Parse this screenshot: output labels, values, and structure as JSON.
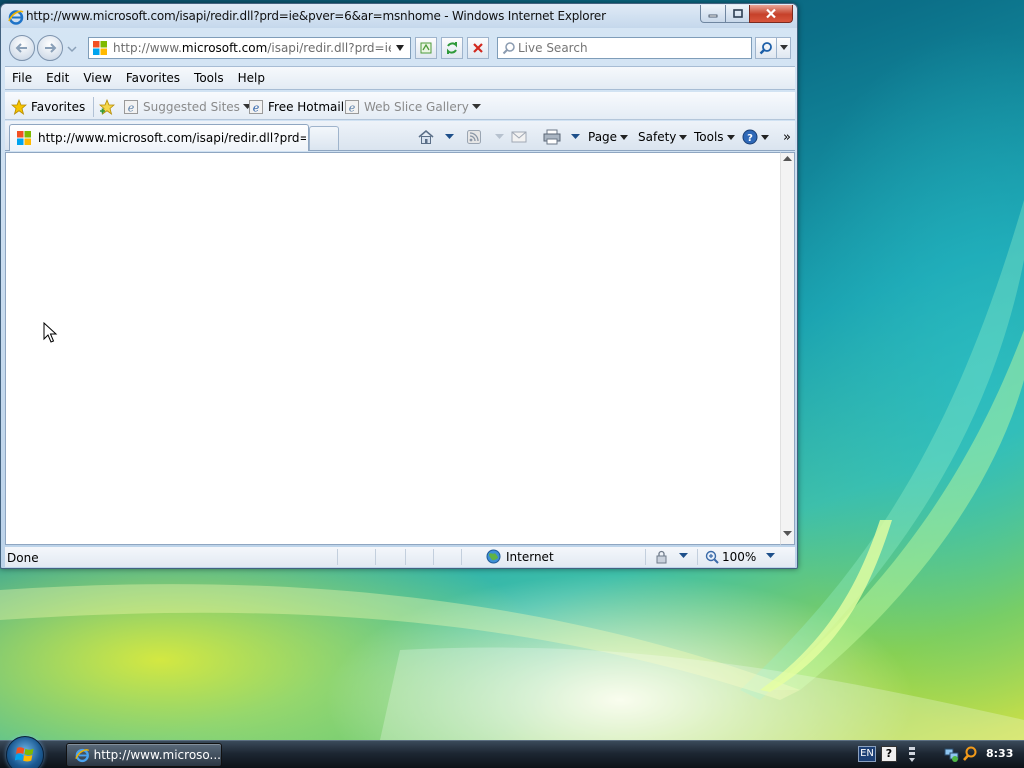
{
  "window": {
    "title": "http://www.microsoft.com/isapi/redir.dll?prd=ie&pver=6&ar=msnhome - Windows Internet Explorer"
  },
  "navbar": {
    "address_prefix": "http://www.",
    "address_domain": "microsoft.com",
    "address_suffix": "/isapi/redir.dll?prd=ie&pv",
    "search_placeholder": "Live Search"
  },
  "menu": {
    "items": [
      "File",
      "Edit",
      "View",
      "Favorites",
      "Tools",
      "Help"
    ]
  },
  "favorites_bar": {
    "favorites_label": "Favorites",
    "suggested_sites": "Suggested Sites",
    "free_hotmail": "Free Hotmail",
    "web_slice_gallery": "Web Slice Gallery"
  },
  "tabs": {
    "active_title": "http://www.microsoft.com/isapi/redir.dll?prd=ie..."
  },
  "command_bar": {
    "page": "Page",
    "safety": "Safety",
    "tools": "Tools",
    "more": "»"
  },
  "status_bar": {
    "status": "Done",
    "zone": "Internet",
    "zoom": "100%"
  },
  "taskbar": {
    "ie_button_label": "http://www.microso...",
    "language": "EN",
    "help": "?",
    "clock": "8:33"
  },
  "colors": {
    "window_frame": "#c5d8ec",
    "close_button": "#c6412a",
    "taskbar": "#1d2733",
    "link_gray": "#8a8a8a"
  },
  "icons": {
    "title": "ie-icon",
    "back": "back-arrow-icon",
    "forward": "forward-arrow-icon",
    "site": "windows-logo-icon",
    "compat": "compatibility-view-icon",
    "refresh": "refresh-icon",
    "stop": "stop-icon",
    "search": "magnifier-icon",
    "home": "home-icon",
    "feeds": "rss-icon",
    "mail": "mail-icon",
    "print": "printer-icon",
    "help": "help-icon",
    "zone": "globe-icon",
    "zoom": "zoom-icon",
    "start": "windows-orb-icon"
  }
}
